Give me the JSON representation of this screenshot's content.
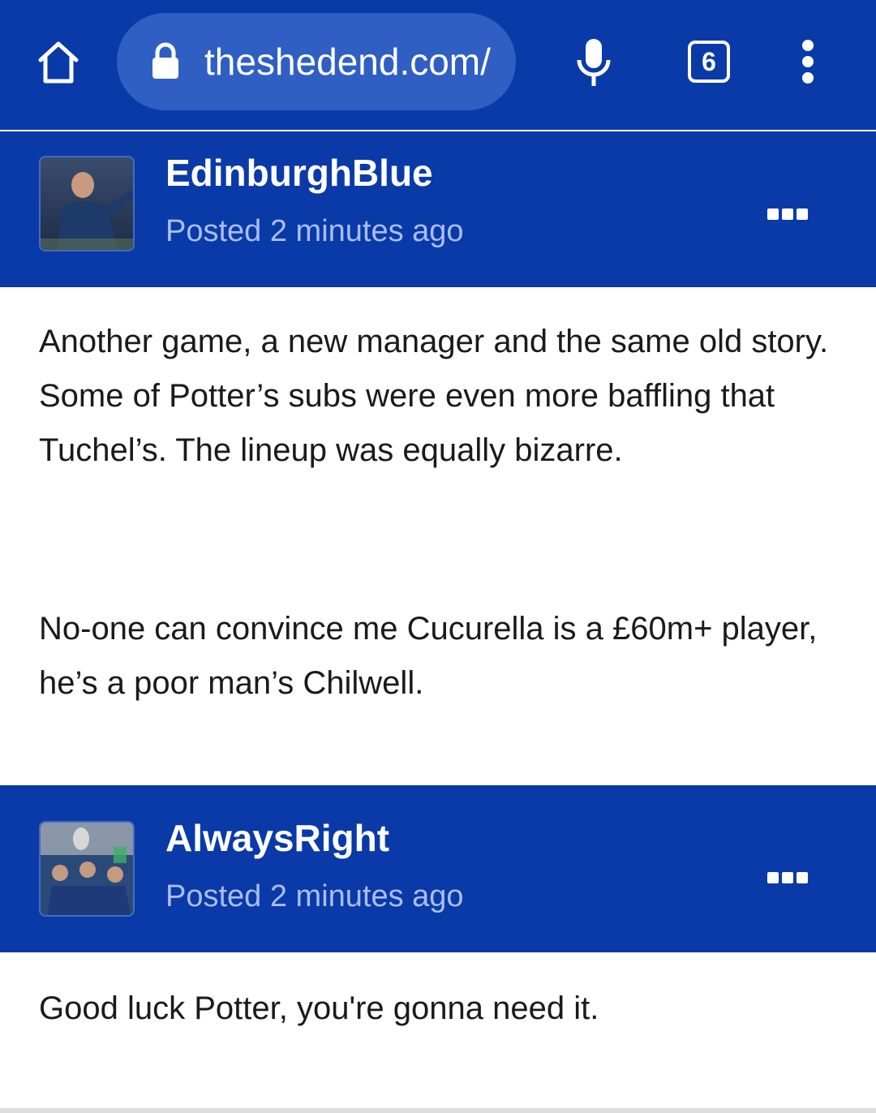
{
  "browser": {
    "url": "theshedend.com/",
    "tab_count": "6",
    "icons": {
      "home": "home-icon",
      "lock": "lock-icon",
      "mic": "microphone-icon",
      "menu": "more-vertical-icon"
    }
  },
  "posts": [
    {
      "username": "EdinburghBlue",
      "posted": "Posted 2 minutes ago",
      "avatar": "avatar-photo",
      "paragraphs": [
        "Another game, a new manager and the same old story. Some of Potter’s subs were even more baffling that Tuchel’s. The lineup was equally bizarre.",
        "No-one can convince me Cucurella is a £60m+ player, he’s a poor man’s Chilwell."
      ]
    },
    {
      "username": "AlwaysRight",
      "posted": "Posted 2 minutes ago",
      "avatar": "avatar-photo",
      "paragraphs": [
        "Good luck Potter, you're gonna need it."
      ]
    }
  ],
  "colors": {
    "brand_blue": "#0a3aa8",
    "url_pill": "#2f5fc2",
    "meta_text": "#a9bdf0",
    "body_text": "#1a1a1a"
  }
}
